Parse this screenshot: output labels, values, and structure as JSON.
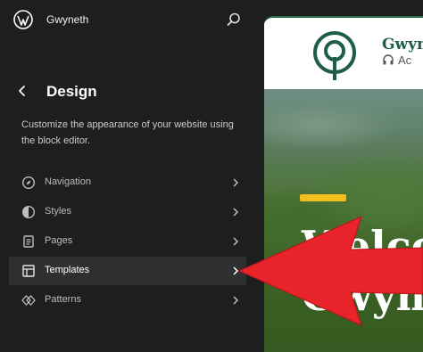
{
  "topbar": {
    "site_name": "Gwyneth",
    "logo_icon": "wordpress-logo-icon",
    "search_icon": "search-icon"
  },
  "panel": {
    "title": "Design",
    "description": "Customize the appearance of your website using the block editor."
  },
  "nav": [
    {
      "label": "Navigation",
      "icon": "compass-icon",
      "active": false
    },
    {
      "label": "Styles",
      "icon": "half-circle-icon",
      "active": false
    },
    {
      "label": "Pages",
      "icon": "page-icon",
      "active": false
    },
    {
      "label": "Templates",
      "icon": "layout-icon",
      "active": true
    },
    {
      "label": "Patterns",
      "icon": "diamond-pattern-icon",
      "active": false
    }
  ],
  "preview": {
    "brand_name": "Gwyn",
    "brand_sub": "Ac",
    "hero_title_line1": "Welco",
    "hero_title_line2": "Gwyn"
  },
  "colors": {
    "sidebar_bg": "#1e1e1e",
    "active_item_bg": "#2f2f2f",
    "brand_green": "#1f5e44",
    "accent_yellow": "#f2bf1e",
    "arrow_red": "#e8232a"
  }
}
